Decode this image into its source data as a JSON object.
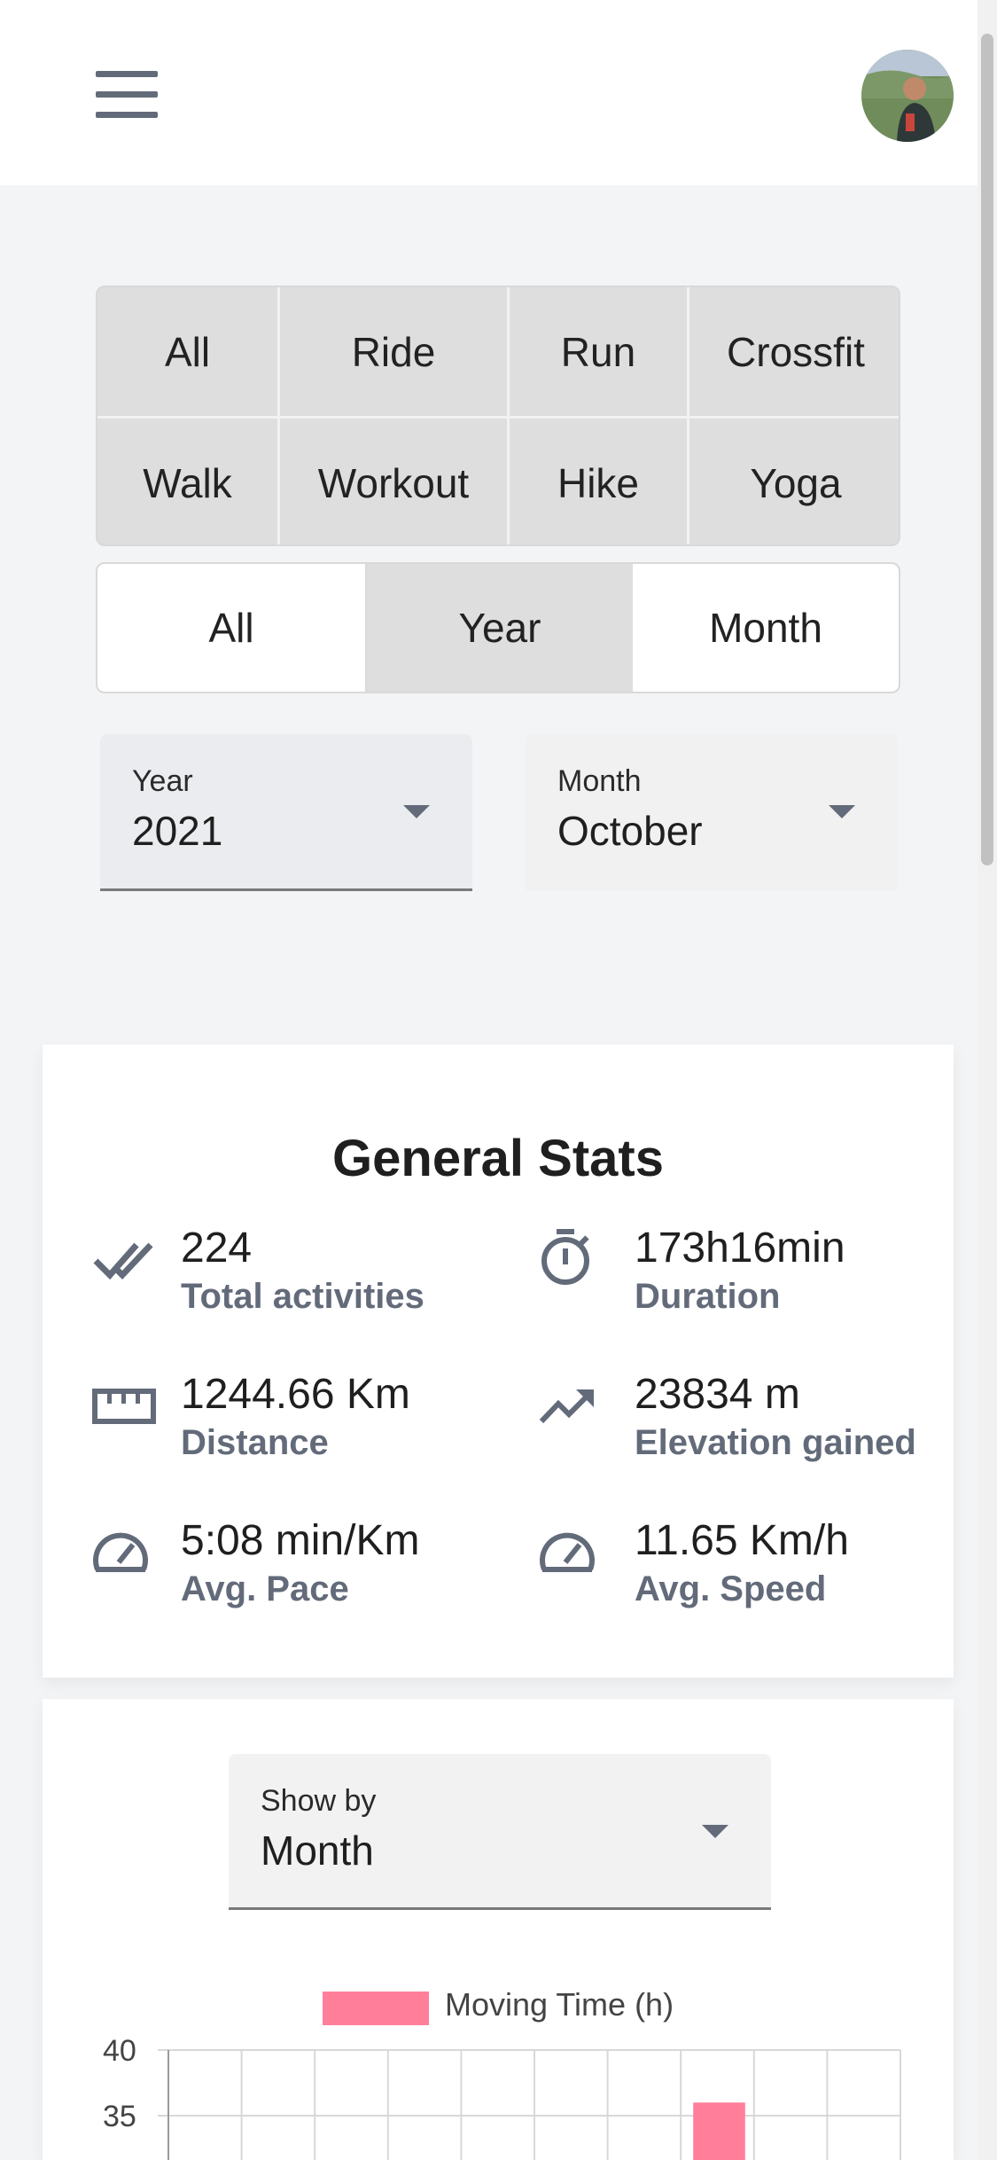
{
  "header": {
    "menu_icon": "menu-icon",
    "avatar_icon": "user-avatar"
  },
  "activity_types": {
    "row1": [
      "All",
      "Ride",
      "Run",
      "Crossfit"
    ],
    "row2": [
      "Walk",
      "Workout",
      "Hike",
      "Yoga"
    ]
  },
  "period": {
    "options": [
      "All",
      "Year",
      "Month"
    ],
    "selected": "Year"
  },
  "filters": {
    "year": {
      "label": "Year",
      "value": "2021"
    },
    "month": {
      "label": "Month",
      "value": "October"
    }
  },
  "general_stats": {
    "title": "General Stats",
    "items": [
      {
        "value": "224",
        "label": "Total activities",
        "icon": "double-check-icon"
      },
      {
        "value": "173h16min",
        "label": "Duration",
        "icon": "stopwatch-icon"
      },
      {
        "value": "1244.66 Km",
        "label": "Distance",
        "icon": "ruler-icon"
      },
      {
        "value": "23834 m",
        "label": "Elevation gained",
        "icon": "trending-up-icon"
      },
      {
        "value": "5:08 min/Km",
        "label": "Avg. Pace",
        "icon": "speedometer-icon"
      },
      {
        "value": "11.65 Km/h",
        "label": "Avg. Speed",
        "icon": "speedometer-icon"
      }
    ]
  },
  "chart_card": {
    "show_by": {
      "label": "Show by",
      "value": "Month"
    }
  },
  "chart_data": {
    "type": "bar",
    "series": [
      {
        "name": "Moving Time (h)",
        "color": "#ff7f9b"
      }
    ],
    "y_ticks_visible": [
      "40",
      "35"
    ],
    "visible_bar_value": 36
  }
}
